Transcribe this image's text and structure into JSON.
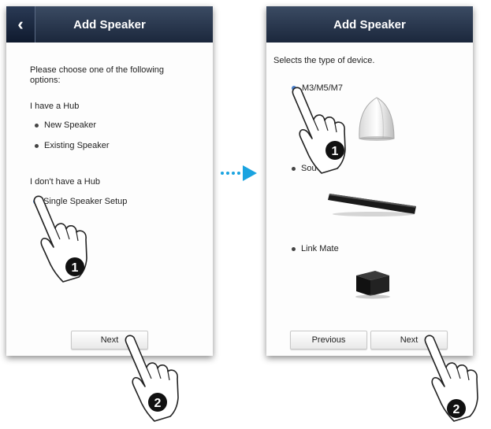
{
  "left_screen": {
    "header_title": "Add Speaker",
    "back_glyph": "‹",
    "intro": "Please choose one of the following options:",
    "hub_heading": "I have a Hub",
    "hub_options": [
      "New Speaker",
      "Existing Speaker"
    ],
    "no_hub_heading": "I don't have a Hub",
    "no_hub_option": "Single Speaker Setup",
    "next_label": "Next"
  },
  "right_screen": {
    "header_title": "Add Speaker",
    "intro": "Selects the type of device.",
    "options": [
      "M3/M5/M7",
      "Sou",
      "Link Mate"
    ],
    "previous_label": "Previous",
    "next_label": "Next"
  },
  "steps": {
    "one": "1",
    "two": "2"
  },
  "icons": [
    "back-chevron-icon",
    "pointing-hand-icon",
    "speaker-icon",
    "soundbar-icon",
    "link-mate-icon",
    "arrow-right-icon"
  ],
  "colors": {
    "header": "#2b3a53",
    "selected_bullet": "#4a7fc8",
    "arrow": "#1aa3e0"
  }
}
